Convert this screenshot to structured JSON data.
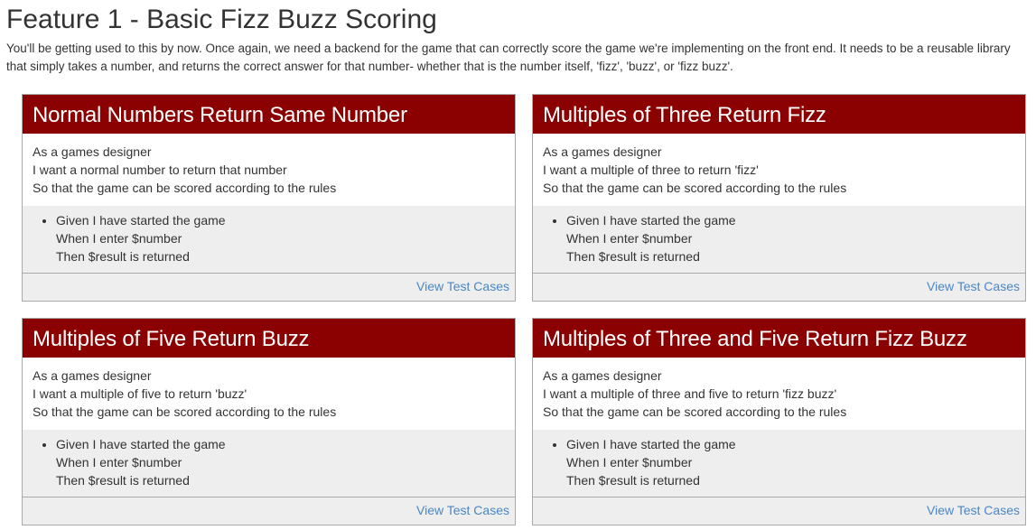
{
  "page": {
    "title": "Feature 1 - Basic Fizz Buzz Scoring",
    "intro": "You'll be getting used to this by now. Once again, we need a backend for the game that can correctly score the game we're implementing on the front end. It needs to be a reusable library that simply takes a number, and returns the correct answer for that number- whether that is the number itself, 'fizz', 'buzz', or 'fizz buzz'."
  },
  "colors": {
    "header_bg": "#8b0000",
    "section_bg": "#eeeeee",
    "link": "#4a86c5"
  },
  "cards": [
    {
      "title": "Normal Numbers Return Same Number",
      "story": [
        "As a games designer",
        "I want a normal number to return that number",
        "So that the game can be scored according to the rules"
      ],
      "criteria": [
        "Given I have started the game",
        "When I enter $number",
        "Then $result is returned"
      ],
      "link": "View Test Cases"
    },
    {
      "title": "Multiples of Three Return Fizz",
      "story": [
        "As a games designer",
        "I want a multiple of three to return 'fizz'",
        "So that the game can be scored according to the rules"
      ],
      "criteria": [
        "Given I have started the game",
        "When I enter $number",
        "Then $result is returned"
      ],
      "link": "View Test Cases"
    },
    {
      "title": "Multiples of Five Return Buzz",
      "story": [
        "As a games designer",
        "I want a multiple of five to return 'buzz'",
        "So that the game can be scored according to the rules"
      ],
      "criteria": [
        "Given I have started the game",
        "When I enter $number",
        "Then $result is returned"
      ],
      "link": "View Test Cases"
    },
    {
      "title": "Multiples of Three and Five Return Fizz Buzz",
      "story": [
        "As a games designer",
        "I want a multiple of three and five to return 'fizz buzz'",
        "So that the game can be scored according to the rules"
      ],
      "criteria": [
        "Given I have started the game",
        "When I enter $number",
        "Then $result is returned"
      ],
      "link": "View Test Cases"
    }
  ]
}
